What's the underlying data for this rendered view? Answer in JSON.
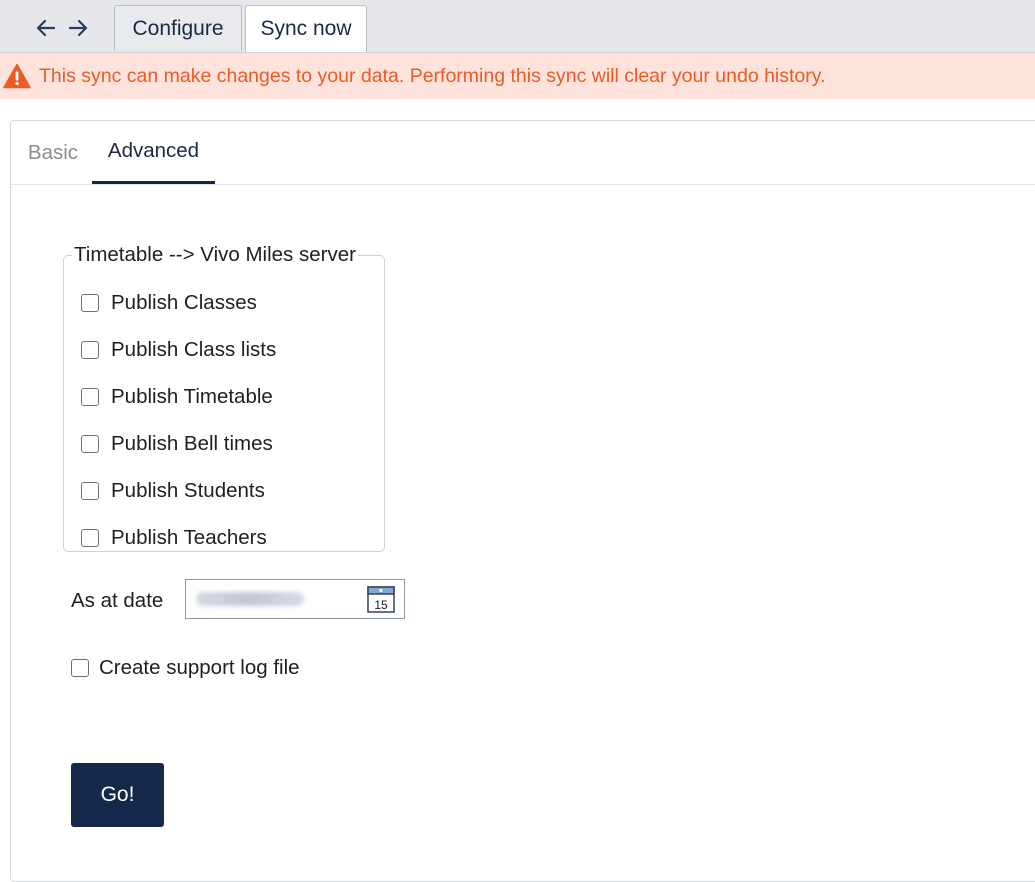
{
  "nav": {
    "back_icon": "arrow-left-icon",
    "forward_icon": "arrow-right-icon"
  },
  "top_tabs": [
    {
      "label": "Configure",
      "active": false
    },
    {
      "label": "Sync now",
      "active": true
    }
  ],
  "warning": {
    "icon": "warning-triangle-icon",
    "text": "This sync can make changes to your data. Performing this sync will clear your undo history.",
    "color": "#ee5a24",
    "background": "#fde3dc"
  },
  "sub_tabs": [
    {
      "label": "Basic",
      "active": false
    },
    {
      "label": "Advanced",
      "active": true
    }
  ],
  "publish_group": {
    "legend": "Timetable --> Vivo Miles server",
    "options": [
      {
        "label": "Publish Classes",
        "checked": false
      },
      {
        "label": "Publish Class lists",
        "checked": false
      },
      {
        "label": "Publish Timetable",
        "checked": false
      },
      {
        "label": "Publish Bell times",
        "checked": false
      },
      {
        "label": "Publish Students",
        "checked": false
      },
      {
        "label": "Publish Teachers",
        "checked": false
      }
    ]
  },
  "as_at_date": {
    "label": "As at date",
    "calendar_icon": "calendar-icon",
    "calendar_day": "15"
  },
  "support_log": {
    "label": "Create support log file",
    "checked": false
  },
  "go_button": {
    "label": "Go!",
    "color": "#14294a"
  }
}
